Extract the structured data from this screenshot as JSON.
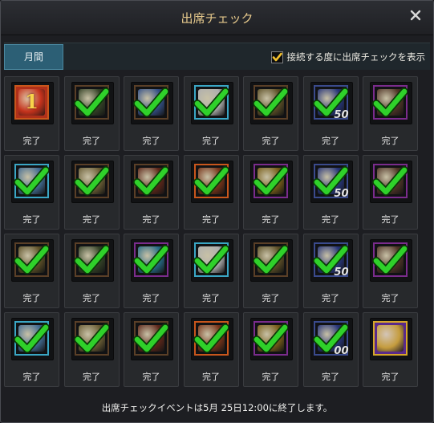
{
  "window": {
    "title": "出席チェック",
    "close_icon": "close-icon"
  },
  "tabs": [
    {
      "label": "月間",
      "active": true
    }
  ],
  "option": {
    "label": "接続する度に出席チェックを表示",
    "checked": true
  },
  "status_label": "完了",
  "days": [
    {
      "item": "rank-1-medal",
      "frame": "orange",
      "status": "完了",
      "checked": false,
      "badge": ""
    },
    {
      "item": "potion-bottle",
      "frame": "brown",
      "status": "完了",
      "checked": true,
      "badge": ""
    },
    {
      "item": "blue-orb",
      "frame": "brown",
      "status": "完了",
      "checked": true,
      "badge": ""
    },
    {
      "item": "scroll",
      "frame": "cyan",
      "status": "完了",
      "checked": true,
      "badge": ""
    },
    {
      "item": "coins",
      "frame": "brown",
      "status": "完了",
      "checked": true,
      "badge": ""
    },
    {
      "item": "crystal",
      "frame": "blue",
      "status": "完了",
      "checked": true,
      "badge": "50"
    },
    {
      "item": "chest",
      "frame": "purple",
      "status": "完了",
      "checked": true,
      "badge": ""
    },
    {
      "item": "blue-disc",
      "frame": "cyan",
      "status": "完了",
      "checked": true,
      "badge": ""
    },
    {
      "item": "tome",
      "frame": "brown",
      "status": "完了",
      "checked": true,
      "badge": ""
    },
    {
      "item": "potion-flask",
      "frame": "brown",
      "status": "完了",
      "checked": true,
      "badge": ""
    },
    {
      "item": "card",
      "frame": "orange",
      "status": "完了",
      "checked": true,
      "badge": ""
    },
    {
      "item": "gold-medal",
      "frame": "purple",
      "status": "完了",
      "checked": true,
      "badge": ""
    },
    {
      "item": "crystal",
      "frame": "blue",
      "status": "完了",
      "checked": true,
      "badge": "50"
    },
    {
      "item": "chest",
      "frame": "purple",
      "status": "完了",
      "checked": true,
      "badge": ""
    },
    {
      "item": "coins",
      "frame": "brown",
      "status": "完了",
      "checked": true,
      "badge": ""
    },
    {
      "item": "potion-bottle",
      "frame": "brown",
      "status": "完了",
      "checked": true,
      "badge": ""
    },
    {
      "item": "gem-box",
      "frame": "purple",
      "status": "完了",
      "checked": true,
      "badge": ""
    },
    {
      "item": "scroll",
      "frame": "cyan",
      "status": "完了",
      "checked": true,
      "badge": ""
    },
    {
      "item": "coins",
      "frame": "brown",
      "status": "完了",
      "checked": true,
      "badge": ""
    },
    {
      "item": "crystal",
      "frame": "blue",
      "status": "完了",
      "checked": true,
      "badge": "50"
    },
    {
      "item": "chest",
      "frame": "purple",
      "status": "完了",
      "checked": true,
      "badge": ""
    },
    {
      "item": "blue-disc",
      "frame": "cyan",
      "status": "完了",
      "checked": true,
      "badge": ""
    },
    {
      "item": "tome",
      "frame": "brown",
      "status": "完了",
      "checked": true,
      "badge": ""
    },
    {
      "item": "potion-flask",
      "frame": "brown",
      "status": "完了",
      "checked": true,
      "badge": ""
    },
    {
      "item": "card",
      "frame": "orange",
      "status": "完了",
      "checked": true,
      "badge": ""
    },
    {
      "item": "gold-medal",
      "frame": "purple",
      "status": "完了",
      "checked": true,
      "badge": ""
    },
    {
      "item": "crystal",
      "frame": "blue",
      "status": "完了",
      "checked": true,
      "badge": "00"
    },
    {
      "item": "golden-ticket",
      "frame": "gold",
      "status": "完了",
      "checked": false,
      "badge": ""
    }
  ],
  "footer": "出席チェックイベントは5月 25日12:00に終了します。",
  "colors": {
    "title": "#e6c98c",
    "tab_active": "#2c5f75",
    "check": "#2fd12a",
    "frame_orange": "#c8561c",
    "frame_brown": "#5a3f27",
    "frame_cyan": "#3aa6c4",
    "frame_blue": "#3a4a8c",
    "frame_purple": "#7a2c8c",
    "frame_gold": "#d6a72a"
  }
}
